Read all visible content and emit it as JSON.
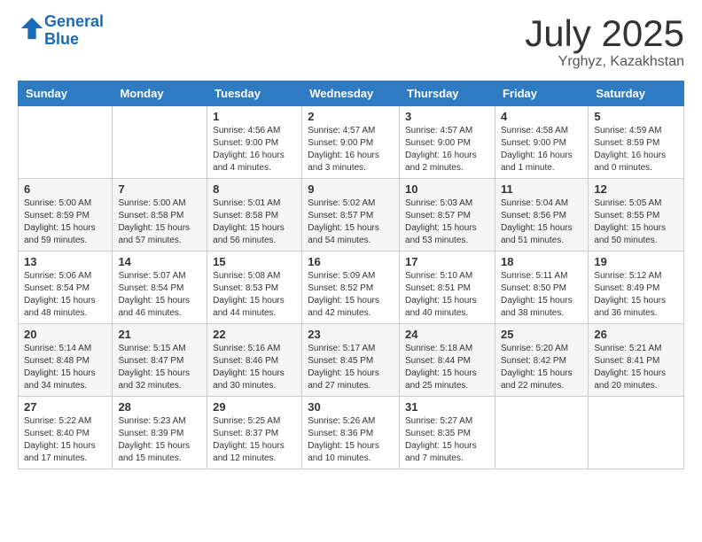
{
  "header": {
    "logo_line1": "General",
    "logo_line2": "Blue",
    "month_year": "July 2025",
    "location": "Yrghyz, Kazakhstan"
  },
  "days_of_week": [
    "Sunday",
    "Monday",
    "Tuesday",
    "Wednesday",
    "Thursday",
    "Friday",
    "Saturday"
  ],
  "weeks": [
    [
      {
        "day": "",
        "info": ""
      },
      {
        "day": "",
        "info": ""
      },
      {
        "day": "1",
        "info": "Sunrise: 4:56 AM\nSunset: 9:00 PM\nDaylight: 16 hours\nand 4 minutes."
      },
      {
        "day": "2",
        "info": "Sunrise: 4:57 AM\nSunset: 9:00 PM\nDaylight: 16 hours\nand 3 minutes."
      },
      {
        "day": "3",
        "info": "Sunrise: 4:57 AM\nSunset: 9:00 PM\nDaylight: 16 hours\nand 2 minutes."
      },
      {
        "day": "4",
        "info": "Sunrise: 4:58 AM\nSunset: 9:00 PM\nDaylight: 16 hours\nand 1 minute."
      },
      {
        "day": "5",
        "info": "Sunrise: 4:59 AM\nSunset: 8:59 PM\nDaylight: 16 hours\nand 0 minutes."
      }
    ],
    [
      {
        "day": "6",
        "info": "Sunrise: 5:00 AM\nSunset: 8:59 PM\nDaylight: 15 hours\nand 59 minutes."
      },
      {
        "day": "7",
        "info": "Sunrise: 5:00 AM\nSunset: 8:58 PM\nDaylight: 15 hours\nand 57 minutes."
      },
      {
        "day": "8",
        "info": "Sunrise: 5:01 AM\nSunset: 8:58 PM\nDaylight: 15 hours\nand 56 minutes."
      },
      {
        "day": "9",
        "info": "Sunrise: 5:02 AM\nSunset: 8:57 PM\nDaylight: 15 hours\nand 54 minutes."
      },
      {
        "day": "10",
        "info": "Sunrise: 5:03 AM\nSunset: 8:57 PM\nDaylight: 15 hours\nand 53 minutes."
      },
      {
        "day": "11",
        "info": "Sunrise: 5:04 AM\nSunset: 8:56 PM\nDaylight: 15 hours\nand 51 minutes."
      },
      {
        "day": "12",
        "info": "Sunrise: 5:05 AM\nSunset: 8:55 PM\nDaylight: 15 hours\nand 50 minutes."
      }
    ],
    [
      {
        "day": "13",
        "info": "Sunrise: 5:06 AM\nSunset: 8:54 PM\nDaylight: 15 hours\nand 48 minutes."
      },
      {
        "day": "14",
        "info": "Sunrise: 5:07 AM\nSunset: 8:54 PM\nDaylight: 15 hours\nand 46 minutes."
      },
      {
        "day": "15",
        "info": "Sunrise: 5:08 AM\nSunset: 8:53 PM\nDaylight: 15 hours\nand 44 minutes."
      },
      {
        "day": "16",
        "info": "Sunrise: 5:09 AM\nSunset: 8:52 PM\nDaylight: 15 hours\nand 42 minutes."
      },
      {
        "day": "17",
        "info": "Sunrise: 5:10 AM\nSunset: 8:51 PM\nDaylight: 15 hours\nand 40 minutes."
      },
      {
        "day": "18",
        "info": "Sunrise: 5:11 AM\nSunset: 8:50 PM\nDaylight: 15 hours\nand 38 minutes."
      },
      {
        "day": "19",
        "info": "Sunrise: 5:12 AM\nSunset: 8:49 PM\nDaylight: 15 hours\nand 36 minutes."
      }
    ],
    [
      {
        "day": "20",
        "info": "Sunrise: 5:14 AM\nSunset: 8:48 PM\nDaylight: 15 hours\nand 34 minutes."
      },
      {
        "day": "21",
        "info": "Sunrise: 5:15 AM\nSunset: 8:47 PM\nDaylight: 15 hours\nand 32 minutes."
      },
      {
        "day": "22",
        "info": "Sunrise: 5:16 AM\nSunset: 8:46 PM\nDaylight: 15 hours\nand 30 minutes."
      },
      {
        "day": "23",
        "info": "Sunrise: 5:17 AM\nSunset: 8:45 PM\nDaylight: 15 hours\nand 27 minutes."
      },
      {
        "day": "24",
        "info": "Sunrise: 5:18 AM\nSunset: 8:44 PM\nDaylight: 15 hours\nand 25 minutes."
      },
      {
        "day": "25",
        "info": "Sunrise: 5:20 AM\nSunset: 8:42 PM\nDaylight: 15 hours\nand 22 minutes."
      },
      {
        "day": "26",
        "info": "Sunrise: 5:21 AM\nSunset: 8:41 PM\nDaylight: 15 hours\nand 20 minutes."
      }
    ],
    [
      {
        "day": "27",
        "info": "Sunrise: 5:22 AM\nSunset: 8:40 PM\nDaylight: 15 hours\nand 17 minutes."
      },
      {
        "day": "28",
        "info": "Sunrise: 5:23 AM\nSunset: 8:39 PM\nDaylight: 15 hours\nand 15 minutes."
      },
      {
        "day": "29",
        "info": "Sunrise: 5:25 AM\nSunset: 8:37 PM\nDaylight: 15 hours\nand 12 minutes."
      },
      {
        "day": "30",
        "info": "Sunrise: 5:26 AM\nSunset: 8:36 PM\nDaylight: 15 hours\nand 10 minutes."
      },
      {
        "day": "31",
        "info": "Sunrise: 5:27 AM\nSunset: 8:35 PM\nDaylight: 15 hours\nand 7 minutes."
      },
      {
        "day": "",
        "info": ""
      },
      {
        "day": "",
        "info": ""
      }
    ]
  ]
}
